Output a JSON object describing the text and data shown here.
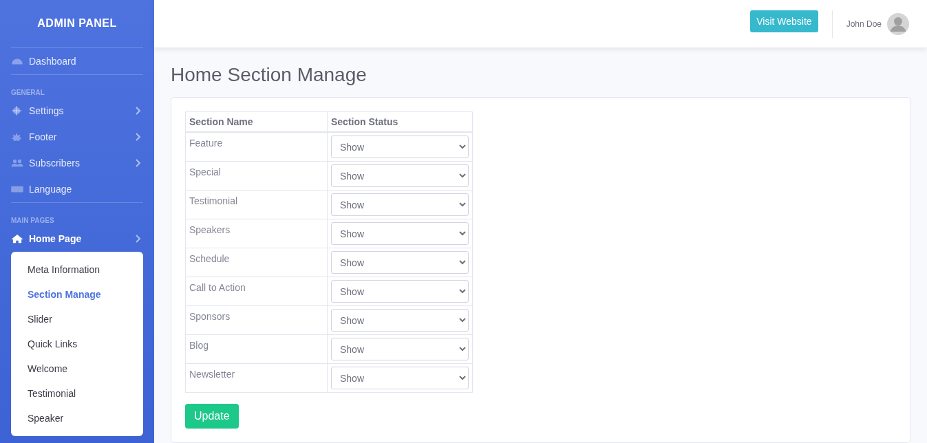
{
  "sidebar": {
    "brand": "ADMIN PANEL",
    "groups": [
      {
        "items": [
          {
            "label": "Dashboard",
            "selected": false
          }
        ]
      },
      {
        "heading": "GENERAL",
        "items": [
          {
            "label": "Settings",
            "has_arrow": true,
            "selected": false
          },
          {
            "label": "Footer",
            "has_arrow": true,
            "selected": false
          },
          {
            "label": "Subscribers",
            "has_arrow": true,
            "selected": false
          },
          {
            "label": "Language",
            "selected": false
          }
        ]
      },
      {
        "heading": "MAIN PAGES",
        "items": [
          {
            "label": "Home Page",
            "has_arrow": true,
            "selected": true,
            "expanded": true,
            "children": [
              {
                "label": "Meta Information",
                "selected": false
              },
              {
                "label": "Section Manage",
                "selected": true
              },
              {
                "label": "Slider",
                "selected": false
              },
              {
                "label": "Quick Links",
                "selected": false
              },
              {
                "label": "Welcome",
                "selected": false
              },
              {
                "label": "Testimonial",
                "selected": false
              },
              {
                "label": "Speaker",
                "selected": false
              }
            ]
          }
        ]
      }
    ]
  },
  "topbar": {
    "visit_button": "Visit Website",
    "user_name": "John Doe"
  },
  "page_title": "Home Section Manage",
  "table": {
    "columns": [
      "Section Name",
      "Section Status"
    ],
    "rows": [
      {
        "name": "Feature",
        "status": "Show"
      },
      {
        "name": "Special",
        "status": "Show"
      },
      {
        "name": "Testimonial",
        "status": "Show"
      },
      {
        "name": "Speakers",
        "status": "Show"
      },
      {
        "name": "Schedule",
        "status": "Show"
      },
      {
        "name": "Call to Action",
        "status": "Show"
      },
      {
        "name": "Sponsors",
        "status": "Show"
      },
      {
        "name": "Blog",
        "status": "Show"
      },
      {
        "name": "Newsletter",
        "status": "Show"
      }
    ]
  },
  "update_button": "Update"
}
